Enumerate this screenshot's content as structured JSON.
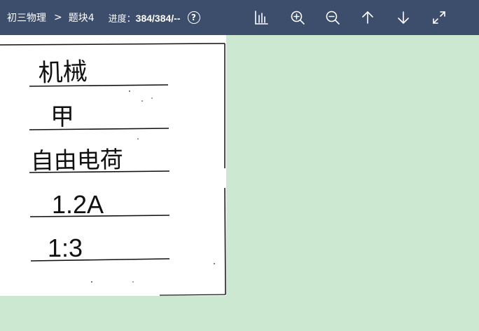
{
  "header": {
    "breadcrumb": [
      "初三物理",
      "题块4"
    ],
    "separator": ">",
    "progress_label": "进度：",
    "progress_value": "384/384/--",
    "help_glyph": "?"
  },
  "toolbar": {
    "icons": [
      "bar-chart-icon",
      "zoom-in-icon",
      "zoom-out-icon",
      "arrow-up-icon",
      "arrow-down-icon",
      "fullscreen-icon"
    ]
  },
  "answer_sheet": {
    "answers": [
      "机械",
      "甲",
      "自由电荷",
      "1.2A",
      "1:3"
    ]
  },
  "colors": {
    "header_bg": "#3d4d6c",
    "canvas_bg": "#cde8d0",
    "paper_bg": "#ffffff",
    "ink": "#111111"
  }
}
